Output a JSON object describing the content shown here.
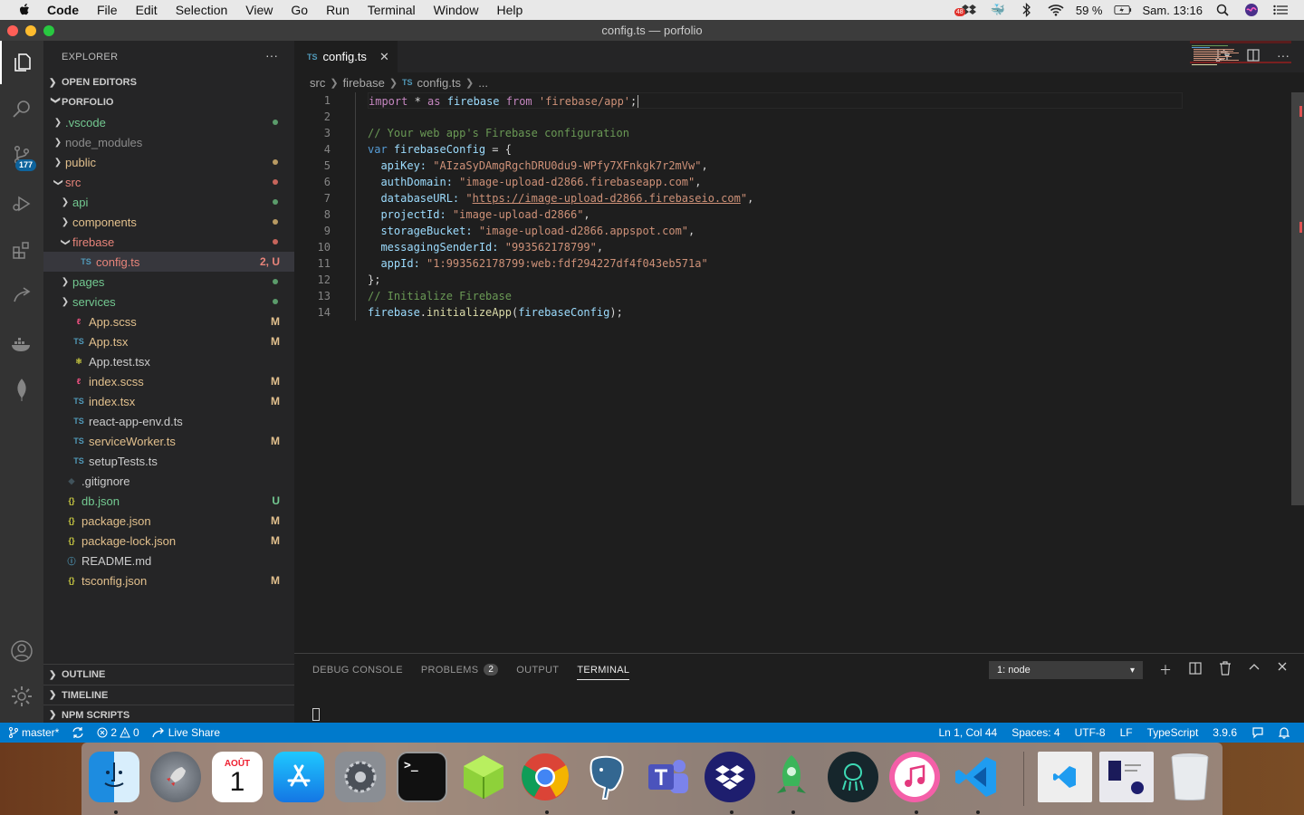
{
  "menubar": {
    "app": "Code",
    "items": [
      "File",
      "Edit",
      "Selection",
      "View",
      "Go",
      "Run",
      "Terminal",
      "Window",
      "Help"
    ],
    "battery": "59 %",
    "clock": "Sam. 13:16",
    "notif_badge": "48"
  },
  "window": {
    "title": "config.ts — porfolio"
  },
  "activity": {
    "scm_badge": "177"
  },
  "sidebar": {
    "title": "EXPLORER",
    "more": "···",
    "open_editors": "OPEN EDITORS",
    "project": "PORFOLIO",
    "files": [
      {
        "name": ".vscode",
        "type": "folder",
        "depth": 1,
        "color": "green",
        "dot": "green"
      },
      {
        "name": "node_modules",
        "type": "folder",
        "depth": 1,
        "color": "grey"
      },
      {
        "name": "public",
        "type": "folder",
        "depth": 1,
        "color": "yellow",
        "dot": "yellow"
      },
      {
        "name": "src",
        "type": "folder-open",
        "depth": 1,
        "color": "red",
        "dot": "red"
      },
      {
        "name": "api",
        "type": "folder",
        "depth": 2,
        "color": "green",
        "dot": "green"
      },
      {
        "name": "components",
        "type": "folder",
        "depth": 2,
        "color": "yellow",
        "dot": "yellow"
      },
      {
        "name": "firebase",
        "type": "folder-open",
        "depth": 2,
        "color": "red",
        "dot": "red"
      },
      {
        "name": "config.ts",
        "type": "ts",
        "depth": 3,
        "color": "red",
        "status": "2, U",
        "selected": true
      },
      {
        "name": "pages",
        "type": "folder",
        "depth": 2,
        "color": "green",
        "dot": "green"
      },
      {
        "name": "services",
        "type": "folder",
        "depth": 2,
        "color": "green",
        "dot": "green"
      },
      {
        "name": "App.scss",
        "type": "scss",
        "depth": 2,
        "color": "yellow",
        "status": "M"
      },
      {
        "name": "App.tsx",
        "type": "ts",
        "depth": 2,
        "color": "yellow",
        "status": "M"
      },
      {
        "name": "App.test.tsx",
        "type": "test",
        "depth": 2,
        "color": "plain"
      },
      {
        "name": "index.scss",
        "type": "scss",
        "depth": 2,
        "color": "yellow",
        "status": "M"
      },
      {
        "name": "index.tsx",
        "type": "ts",
        "depth": 2,
        "color": "yellow",
        "status": "M"
      },
      {
        "name": "react-app-env.d.ts",
        "type": "ts",
        "depth": 2,
        "color": "plain"
      },
      {
        "name": "serviceWorker.ts",
        "type": "ts",
        "depth": 2,
        "color": "yellow",
        "status": "M"
      },
      {
        "name": "setupTests.ts",
        "type": "ts",
        "depth": 2,
        "color": "plain"
      },
      {
        "name": ".gitignore",
        "type": "git",
        "depth": 1,
        "color": "plain"
      },
      {
        "name": "db.json",
        "type": "json",
        "depth": 1,
        "color": "green",
        "status": "U"
      },
      {
        "name": "package.json",
        "type": "json",
        "depth": 1,
        "color": "yellow",
        "status": "M"
      },
      {
        "name": "package-lock.json",
        "type": "json",
        "depth": 1,
        "color": "yellow",
        "status": "M"
      },
      {
        "name": "README.md",
        "type": "info",
        "depth": 1,
        "color": "plain"
      },
      {
        "name": "tsconfig.json",
        "type": "json",
        "depth": 1,
        "color": "yellow",
        "status": "M"
      }
    ],
    "bottom_sections": [
      "OUTLINE",
      "TIMELINE",
      "NPM SCRIPTS"
    ]
  },
  "editor": {
    "tab": "config.ts",
    "tab_icon": "TS",
    "breadcrumb": [
      "src",
      "firebase",
      "config.ts",
      "..."
    ],
    "lines": [
      [
        [
          "kw",
          "import"
        ],
        [
          "p",
          " * "
        ],
        [
          "kw",
          "as"
        ],
        [
          "v",
          " firebase "
        ],
        [
          "kw",
          "from"
        ],
        [
          "s",
          " 'firebase/app'"
        ],
        [
          "p",
          ";"
        ]
      ],
      [],
      [
        [
          "cm",
          "// Your web app's Firebase configuration"
        ]
      ],
      [
        [
          "k",
          "var"
        ],
        [
          "v",
          " firebaseConfig"
        ],
        [
          "p",
          " = {"
        ]
      ],
      [
        [
          "v",
          "  apiKey: "
        ],
        [
          "s",
          "\"AIzaSyDAmgRgchDRU0du9-WPfy7XFnkgk7r2mVw\""
        ],
        [
          "p",
          ","
        ]
      ],
      [
        [
          "v",
          "  authDomain: "
        ],
        [
          "s",
          "\"image-upload-d2866.firebaseapp.com\""
        ],
        [
          "p",
          ","
        ]
      ],
      [
        [
          "v",
          "  databaseURL: "
        ],
        [
          "s",
          "\""
        ],
        [
          "su",
          "https://image-upload-d2866.firebaseio.com"
        ],
        [
          "s",
          "\""
        ],
        [
          "p",
          ","
        ]
      ],
      [
        [
          "v",
          "  projectId: "
        ],
        [
          "s",
          "\"image-upload-d2866\""
        ],
        [
          "p",
          ","
        ]
      ],
      [
        [
          "v",
          "  storageBucket: "
        ],
        [
          "s",
          "\"image-upload-d2866.appspot.com\""
        ],
        [
          "p",
          ","
        ]
      ],
      [
        [
          "v",
          "  messagingSenderId: "
        ],
        [
          "s",
          "\"993562178799\""
        ],
        [
          "p",
          ","
        ]
      ],
      [
        [
          "v",
          "  appId: "
        ],
        [
          "s",
          "\"1:993562178799:web:fdf294227df4f043eb571a\""
        ]
      ],
      [
        [
          "p",
          "};"
        ]
      ],
      [
        [
          "cm",
          "// Initialize Firebase"
        ]
      ],
      [
        [
          "v",
          "firebase"
        ],
        [
          "p",
          "."
        ],
        [
          "fn",
          "initializeApp"
        ],
        [
          "p",
          "("
        ],
        [
          "v",
          "firebaseConfig"
        ],
        [
          "p",
          ");"
        ]
      ]
    ]
  },
  "panel": {
    "tabs": [
      "DEBUG CONSOLE",
      "PROBLEMS",
      "OUTPUT",
      "TERMINAL"
    ],
    "problems_count": "2",
    "active_tab": "TERMINAL",
    "terminal_select": "1: node"
  },
  "status": {
    "branch": "master*",
    "errors": "2",
    "warnings": "0",
    "liveshare": "Live Share",
    "position": "Ln 1, Col 44",
    "spaces": "Spaces: 4",
    "encoding": "UTF-8",
    "eol": "LF",
    "language": "TypeScript",
    "version": "3.9.6"
  },
  "dock": {
    "calendar_month": "AOÛT",
    "calendar_day": "1",
    "apps": [
      "finder-icon",
      "launchpad-icon",
      "calendar-icon",
      "app-store-icon",
      "system-preferences-icon",
      "terminal-icon",
      "cube-app-icon",
      "chrome-icon",
      "postgres-icon",
      "teams-icon",
      "dropbox-icon",
      "rocket-app-icon",
      "gitkraken-icon",
      "itunes-icon",
      "vscode-icon",
      "recent-doc-1-icon",
      "recent-doc-2-icon",
      "trash-icon"
    ]
  }
}
